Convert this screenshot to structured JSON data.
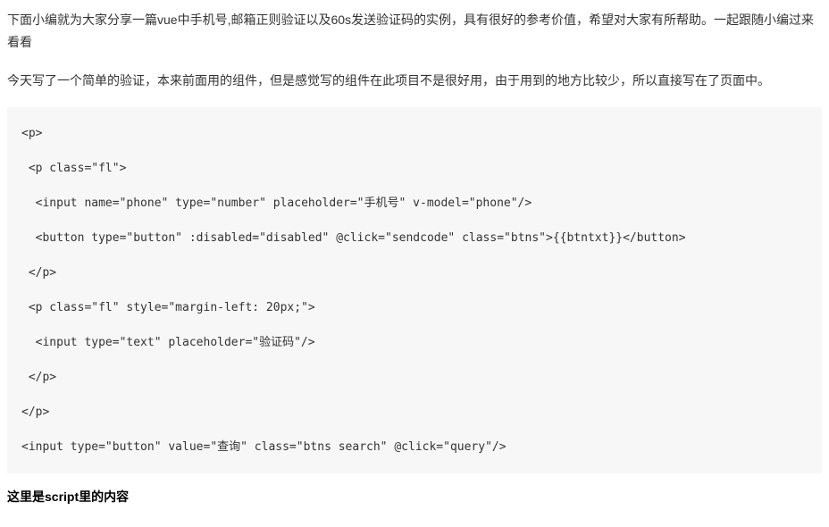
{
  "intro": {
    "p1": "下面小编就为大家分享一篇vue中手机号,邮箱正则验证以及60s发送验证码的实例，具有很好的参考价值，希望对大家有所帮助。一起跟随小编过来看看",
    "p2": "今天写了一个简单的验证，本来前面用的组件，但是感觉写的组件在此项目不是很好用，由于用到的地方比较少，所以直接写在了页面中。"
  },
  "code": {
    "line1": "<p>",
    "line2": " <p class=\"fl\">",
    "line3": "  <input name=\"phone\" type=\"number\" placeholder=\"手机号\" v-model=\"phone\"/>",
    "line4": "  <button type=\"button\" :disabled=\"disabled\" @click=\"sendcode\" class=\"btns\">{{btntxt}}</button>",
    "line5": " </p>",
    "line6": " <p class=\"fl\" style=\"margin-left: 20px;\">",
    "line7": "  <input type=\"text\" placeholder=\"验证码\"/>",
    "line8": " </p>",
    "line9": "</p>",
    "line10": "<input type=\"button\" value=\"查询\" class=\"btns search\" @click=\"query\"/>"
  },
  "heading": "这里是script里的内容"
}
